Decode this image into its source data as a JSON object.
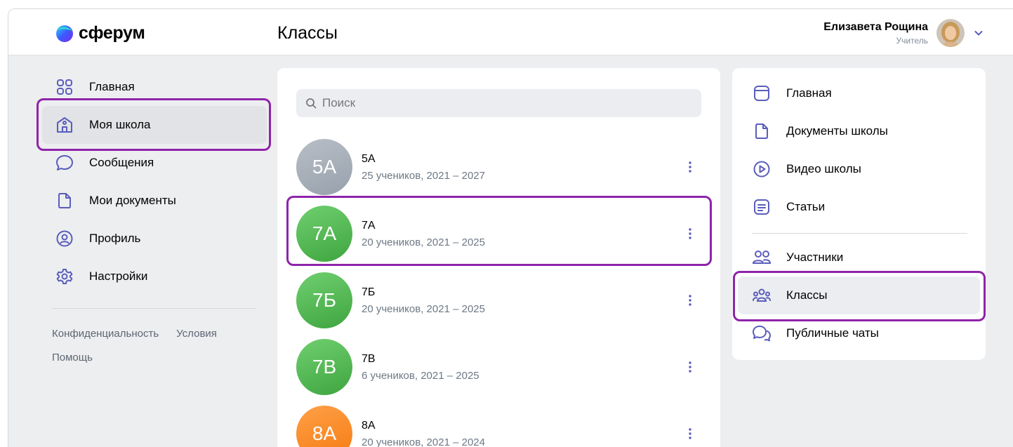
{
  "app": {
    "logo_text": "сферум",
    "page_title": "Классы"
  },
  "user": {
    "name": "Елизавета Рощина",
    "role": "Учитель"
  },
  "left_nav": {
    "items": [
      {
        "label": "Главная",
        "icon": "grid-icon"
      },
      {
        "label": "Моя школа",
        "icon": "school-icon",
        "active": true
      },
      {
        "label": "Сообщения",
        "icon": "message-icon"
      },
      {
        "label": "Мои документы",
        "icon": "document-icon"
      },
      {
        "label": "Профиль",
        "icon": "profile-icon"
      },
      {
        "label": "Настройки",
        "icon": "gear-icon"
      }
    ],
    "footer": {
      "privacy": "Конфиденциальность",
      "terms": "Условия",
      "help": "Помощь"
    }
  },
  "search": {
    "placeholder": "Поиск"
  },
  "classes": [
    {
      "badge": "5А",
      "name": "5А",
      "meta": "25 учеников, 2021 – 2027",
      "color": "#a4acb6"
    },
    {
      "badge": "7А",
      "name": "7А",
      "meta": "20 учеников, 2021 – 2025",
      "color": "#4bb34b"
    },
    {
      "badge": "7Б",
      "name": "7Б",
      "meta": "20 учеников, 2021 – 2025",
      "color": "#4bb34b"
    },
    {
      "badge": "7В",
      "name": "7В",
      "meta": "6 учеников, 2021 – 2025",
      "color": "#4bb34b"
    },
    {
      "badge": "8А",
      "name": "8А",
      "meta": "20 учеников, 2021 – 2024",
      "color": "#ff8a1f"
    }
  ],
  "right_nav": {
    "items": [
      {
        "label": "Главная",
        "icon": "browser-icon"
      },
      {
        "label": "Документы школы",
        "icon": "document-icon"
      },
      {
        "label": "Видео школы",
        "icon": "play-icon"
      },
      {
        "label": "Статьи",
        "icon": "article-icon"
      },
      {
        "label": "Участники",
        "icon": "users-icon"
      },
      {
        "label": "Классы",
        "icon": "classes-icon",
        "active": true
      },
      {
        "label": "Публичные чаты",
        "icon": "chats-icon"
      }
    ]
  },
  "colors": {
    "accent": "#5a5dbb",
    "highlight": "#8e24aa"
  }
}
